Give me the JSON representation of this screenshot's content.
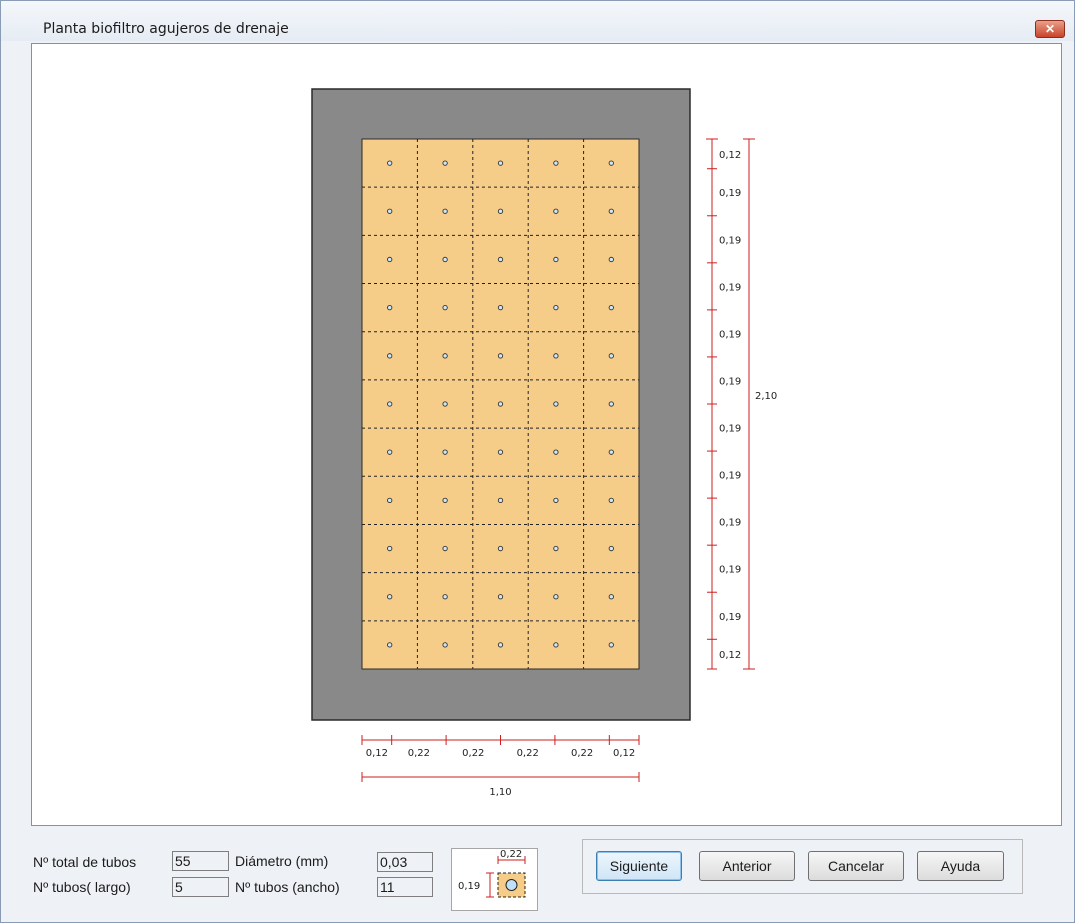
{
  "window": {
    "title": "Planta biofiltro agujeros de drenaje",
    "close_symbol": "✕"
  },
  "plan": {
    "rows": 11,
    "cols": 5,
    "right_dims": [
      "0,12",
      "0,19",
      "0,19",
      "0,19",
      "0,19",
      "0,19",
      "0,19",
      "0,19",
      "0,19",
      "0,19",
      "0,19",
      "0,12"
    ],
    "total_length": "2,10",
    "bottom_dims": [
      "0,12",
      "0,22",
      "0,22",
      "0,22",
      "0,22",
      "0,12"
    ],
    "total_width": "1,10",
    "colors": {
      "wall": "#898989",
      "fill": "#f5cd88",
      "dim": "#cc1f1f"
    }
  },
  "fields": {
    "total_tubos_label": "Nº total de tubos",
    "total_tubos_value": "55",
    "tubos_largo_label": "Nº tubos( largo)",
    "tubos_largo_value": "5",
    "diametro_label": "Diámetro (mm)",
    "diametro_value": "0,03",
    "tubos_ancho_label": "Nº tubos (ancho)",
    "tubos_ancho_value": "11"
  },
  "legend": {
    "width": "0,22",
    "height": "0,19"
  },
  "buttons": {
    "next": "Siguiente",
    "previous": "Anterior",
    "cancel": "Cancelar",
    "help": "Ayuda"
  }
}
